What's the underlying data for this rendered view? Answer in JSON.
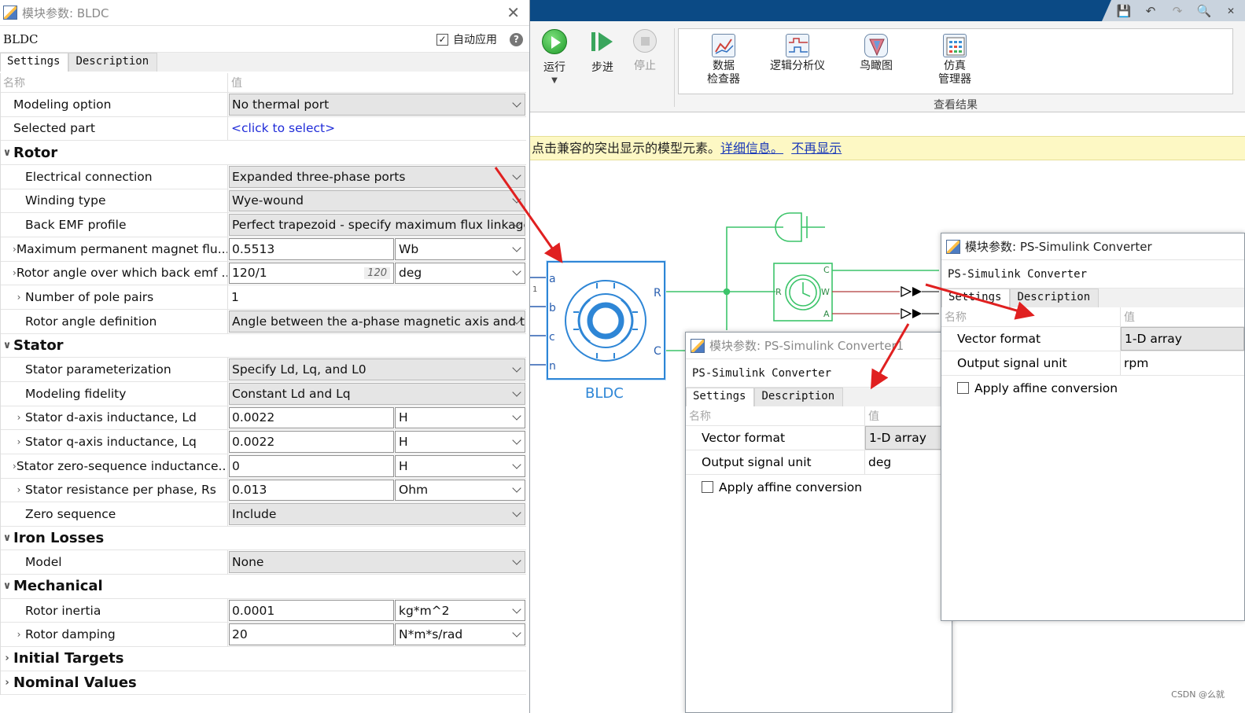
{
  "left_dialog": {
    "title": "模块参数: BLDC",
    "block_name": "BLDC",
    "auto_apply_label": "自动应用",
    "tabs": [
      "Settings",
      "Description"
    ],
    "header": {
      "name_col": "名称",
      "value_col": "值"
    },
    "rows": {
      "modeling_option": {
        "label": "Modeling option",
        "value": "No thermal port"
      },
      "selected_part": {
        "label": "Selected part",
        "value": "<click to select>"
      },
      "rotor": "Rotor",
      "electrical_connection": {
        "label": "Electrical connection",
        "value": "Expanded three-phase ports"
      },
      "winding_type": {
        "label": "Winding type",
        "value": "Wye-wound"
      },
      "back_emf_profile": {
        "label": "Back EMF profile",
        "value": "Perfect trapezoid - specify maximum flux linkage"
      },
      "max_flux": {
        "label": "Maximum permanent magnet flu...",
        "value": "0.5513",
        "unit": "Wb"
      },
      "rotor_angle_backemf": {
        "label": "Rotor angle over which back emf ...",
        "value": "120/1",
        "hint": "120",
        "unit": "deg"
      },
      "pole_pairs": {
        "label": "Number of pole pairs",
        "value": "1"
      },
      "rotor_angle_def": {
        "label": "Rotor angle definition",
        "value": "Angle between the a-phase magnetic axis and the"
      },
      "stator": "Stator",
      "stator_param": {
        "label": "Stator parameterization",
        "value": "Specify Ld, Lq, and L0"
      },
      "modeling_fidelity": {
        "label": "Modeling fidelity",
        "value": "Constant Ld and Lq"
      },
      "ld": {
        "label": "Stator d-axis inductance, Ld",
        "value": "0.0022",
        "unit": "H"
      },
      "lq": {
        "label": "Stator q-axis inductance, Lq",
        "value": "0.0022",
        "unit": "H"
      },
      "l0": {
        "label": "Stator zero-sequence inductance...",
        "value": "0",
        "unit": "H"
      },
      "rs": {
        "label": "Stator resistance per phase, Rs",
        "value": "0.013",
        "unit": "Ohm"
      },
      "zero_sequence": {
        "label": "Zero sequence",
        "value": "Include"
      },
      "iron_losses": "Iron Losses",
      "model": {
        "label": "Model",
        "value": "None"
      },
      "mechanical": "Mechanical",
      "rotor_inertia": {
        "label": "Rotor inertia",
        "value": "0.0001",
        "unit": "kg*m^2"
      },
      "rotor_damping": {
        "label": "Rotor damping",
        "value": "20",
        "unit": "N*m*s/rad"
      },
      "initial_targets": "Initial Targets",
      "nominal_values": "Nominal Values"
    }
  },
  "toolstrip": {
    "run": "运行",
    "step": "步进",
    "stop": "停止",
    "data_inspector": [
      "数据",
      "检查器"
    ],
    "logic_analyzer": "逻辑分析仪",
    "birds_eye": "鸟瞰图",
    "sim_manager": [
      "仿真",
      "管理器"
    ],
    "group_label": "查看结果"
  },
  "infobar": {
    "text": "点击兼容的突出显示的模型元素。",
    "link_more": "详细信息。",
    "link_hide": "不再显示"
  },
  "diagram": {
    "block_label": "BLDC",
    "ports_left": [
      "a",
      "b",
      "c",
      "n"
    ],
    "ports_right": [
      "R",
      "C"
    ],
    "sensor_ports": [
      "R",
      "C",
      "W",
      "A"
    ],
    "edge_label": "1"
  },
  "converter_dialog_1": {
    "title": "模块参数: PS-Simulink Converter1",
    "block_name": "PS-Simulink Converter",
    "tabs": [
      "Settings",
      "Description"
    ],
    "header": {
      "name_col": "名称",
      "value_col": "值"
    },
    "vector_format": {
      "label": "Vector format",
      "value": "1-D array"
    },
    "output_unit": {
      "label": "Output signal unit",
      "value": "deg"
    },
    "affine": "Apply affine conversion"
  },
  "converter_dialog_2": {
    "title": "模块参数: PS-Simulink Converter",
    "block_name": "PS-Simulink Converter",
    "tabs": [
      "Settings",
      "Description"
    ],
    "header": {
      "name_col": "名称",
      "value_col": "值"
    },
    "vector_format": {
      "label": "Vector format",
      "value": "1-D array"
    },
    "output_unit": {
      "label": "Output signal unit",
      "value": "rpm"
    },
    "affine": "Apply affine conversion"
  },
  "watermark": "CSDN @么就",
  "colors": {
    "title_bar": "#0b4a85",
    "block_blue": "#2e86d6",
    "wire_green": "#3cc46a",
    "arrow_red": "#e02020",
    "infobar_bg": "#fdf8c4"
  }
}
